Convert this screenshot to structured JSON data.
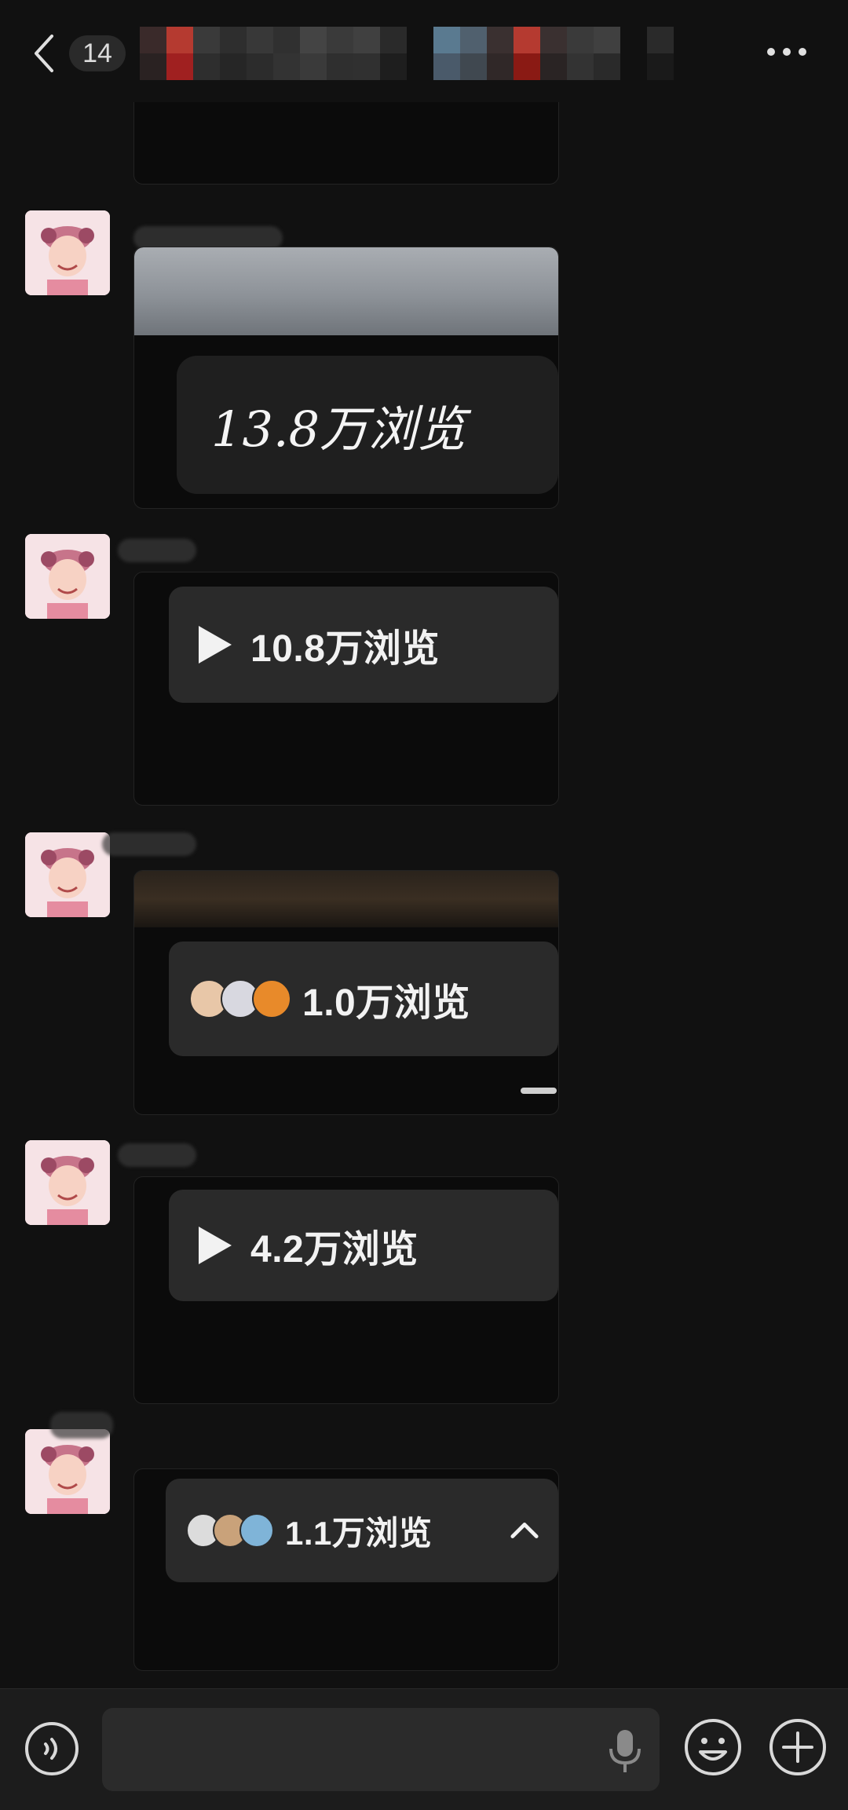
{
  "header": {
    "back_icon": "chevron-left-icon",
    "unread_count": "14",
    "title": "",
    "menu_icon": "more-horizontal-icon"
  },
  "messages": [
    {
      "views": "13.8万浏览",
      "style": "handwritten",
      "icon": "none"
    },
    {
      "views": "10.8万浏览",
      "icon": "play-icon"
    },
    {
      "views": "1.0万浏览",
      "icon": "viewer-avatars"
    },
    {
      "views": "4.2万浏览",
      "icon": "play-icon"
    },
    {
      "views": "1.1万浏览",
      "icon": "viewer-avatars",
      "trailing_icon": "chevron-up-icon"
    }
  ],
  "input_bar": {
    "voice_icon": "voice-mode-icon",
    "placeholder": "",
    "mic_icon": "microphone-icon",
    "emoji_icon": "emoji-icon",
    "plus_icon": "plus-circle-icon"
  },
  "colors": {
    "background": "#111111",
    "card": "#0b0b0b",
    "pill": "#2a2a2a",
    "bottom_bar": "#1c1c1c"
  }
}
